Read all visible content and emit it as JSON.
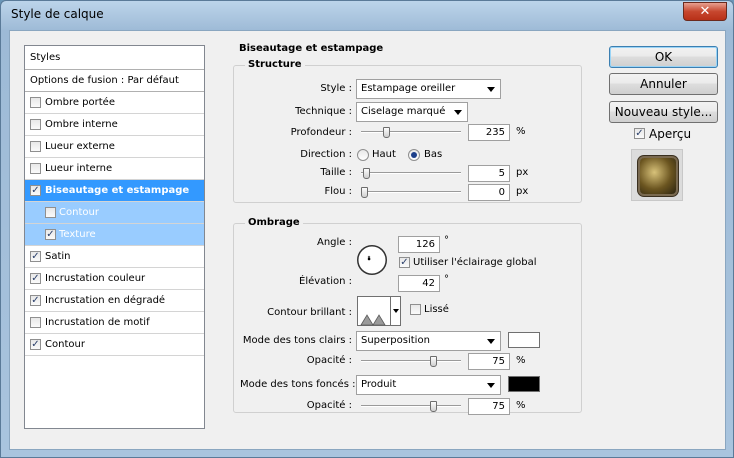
{
  "window": {
    "title": "Style de calque",
    "close_glyph": "✕"
  },
  "styles_panel": {
    "header": "Styles",
    "blend_options": "Options de fusion : Par défaut",
    "items": [
      {
        "label": "Ombre portée",
        "checked": false
      },
      {
        "label": "Ombre interne",
        "checked": false
      },
      {
        "label": "Lueur externe",
        "checked": false
      },
      {
        "label": "Lueur interne",
        "checked": false
      },
      {
        "label": "Biseautage et estampage",
        "checked": true,
        "selected": true
      },
      {
        "label": "Contour",
        "checked": false,
        "sub": true
      },
      {
        "label": "Texture",
        "checked": true,
        "sub": true
      },
      {
        "label": "Satin",
        "checked": true
      },
      {
        "label": "Incrustation couleur",
        "checked": true
      },
      {
        "label": "Incrustation en dégradé",
        "checked": true
      },
      {
        "label": "Incrustation de motif",
        "checked": false
      },
      {
        "label": "Contour",
        "checked": true
      }
    ]
  },
  "bevel": {
    "section_title": "Biseautage et estampage",
    "structure": {
      "title": "Structure",
      "style_label": "Style :",
      "style_value": "Estampage oreiller",
      "technique_label": "Technique :",
      "technique_value": "Ciselage marqué",
      "depth_label": "Profondeur :",
      "depth_value": "235",
      "depth_unit": "%",
      "depth_fraction": 0.235,
      "direction_label": "Direction :",
      "direction_up": "Haut",
      "direction_down": "Bas",
      "direction_selected": "Bas",
      "size_label": "Taille :",
      "size_value": "5",
      "size_unit": "px",
      "size_fraction": 0.02,
      "soften_label": "Flou :",
      "soften_value": "0",
      "soften_unit": "px",
      "soften_fraction": 0.0
    },
    "shading": {
      "title": "Ombrage",
      "angle_label": "Angle :",
      "angle_value": "126",
      "angle_unit": "°",
      "global_light_label": "Utiliser l'éclairage global",
      "global_light_checked": true,
      "altitude_label": "Élévation :",
      "altitude_value": "42",
      "altitude_unit": "°",
      "gloss_contour_label": "Contour brillant :",
      "antialiased_label": "Lissé",
      "antialiased_checked": false,
      "highlight_mode_label": "Mode des tons clairs :",
      "highlight_mode_value": "Superposition",
      "highlight_color": "#ffffff",
      "highlight_opacity_label": "Opacité :",
      "highlight_opacity_value": "75",
      "highlight_opacity_unit": "%",
      "highlight_opacity_fraction": 0.75,
      "shadow_mode_label": "Mode des tons foncés :",
      "shadow_mode_value": "Produit",
      "shadow_color": "#000000",
      "shadow_opacity_label": "Opacité :",
      "shadow_opacity_value": "75",
      "shadow_opacity_unit": "%",
      "shadow_opacity_fraction": 0.75
    }
  },
  "actions": {
    "ok": "OK",
    "cancel": "Annuler",
    "new_style": "Nouveau style...",
    "preview_label": "Aperçu",
    "preview_checked": true
  }
}
